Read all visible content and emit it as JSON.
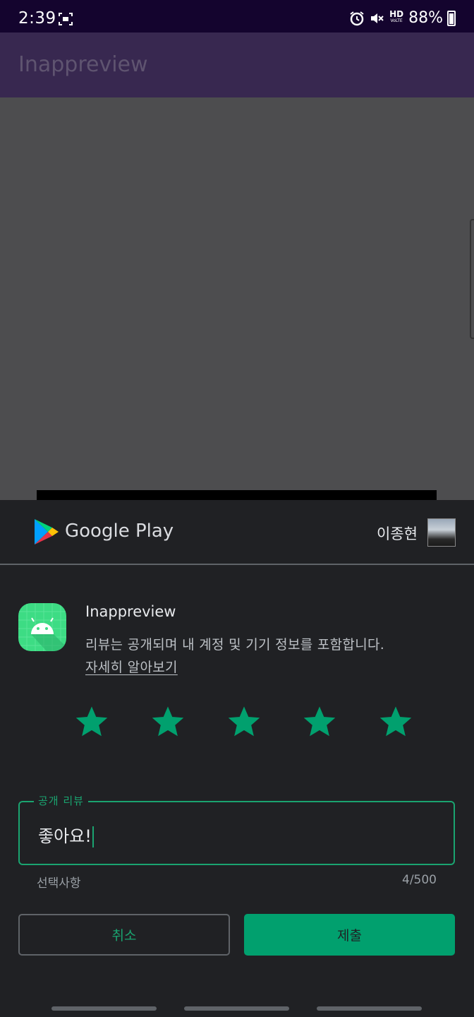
{
  "status_bar": {
    "time": "2:39",
    "battery": "88%",
    "hd_label": "HD",
    "hd_sub": "VoLTE",
    "icons": [
      "screen-record-icon",
      "alarm-icon",
      "mute-icon",
      "hd-voice-icon",
      "battery-icon"
    ]
  },
  "app_bar": {
    "title": "Inappreview"
  },
  "review_sheet": {
    "brand": "Google Play",
    "account_name": "이종현",
    "app_name": "Inappreview",
    "notice": "리뷰는 공개되며 내 계정 및 기기 정보를 포함합니다.",
    "learn_more": "자세히 알아보기",
    "rating": 5,
    "rating_max": 5,
    "field_label": "공개 리뷰",
    "field_value": "좋아요!",
    "helper_left": "선택사항",
    "char_count": "4/500",
    "cancel_label": "취소",
    "submit_label": "제출"
  },
  "colors": {
    "accent": "#01a06e",
    "star": "#01a06e",
    "status_bar_bg": "#14042e",
    "app_bar_bg": "#382850",
    "sheet_bg": "#202124"
  }
}
